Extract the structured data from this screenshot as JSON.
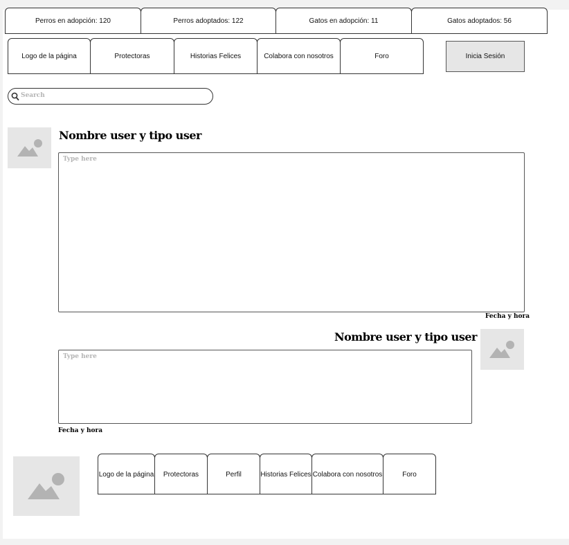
{
  "stats": [
    {
      "label": "Perros en adopción: 120"
    },
    {
      "label": "Perros adoptados: 122"
    },
    {
      "label": "Gatos en adopción: 11"
    },
    {
      "label": "Gatos adoptados: 56"
    }
  ],
  "nav": {
    "items": [
      {
        "label": "Logo de la página"
      },
      {
        "label": "Protectoras"
      },
      {
        "label": "Historias Felices"
      },
      {
        "label": "Colabora con nosotros"
      },
      {
        "label": "Foro"
      }
    ],
    "login_label": "Inicia Sesión"
  },
  "search": {
    "placeholder": "Search"
  },
  "posts": [
    {
      "username": "Nombre user y tipo user",
      "placeholder": "Type here",
      "datetime": "Fecha y hora"
    },
    {
      "username": "Nombre user y tipo user",
      "placeholder": "Type here",
      "datetime": "Fecha y hora"
    }
  ],
  "footer": {
    "items": [
      {
        "label": "Logo de la página"
      },
      {
        "label": "Protectoras"
      },
      {
        "label": "Perfil"
      },
      {
        "label": "Historias Felices"
      },
      {
        "label": "Colabora con nosotros"
      },
      {
        "label": "Foro"
      }
    ]
  },
  "colors": {
    "placeholder_bg": "#e6e6e6",
    "placeholder_icon": "#b3b3b3",
    "border": "#333333"
  }
}
